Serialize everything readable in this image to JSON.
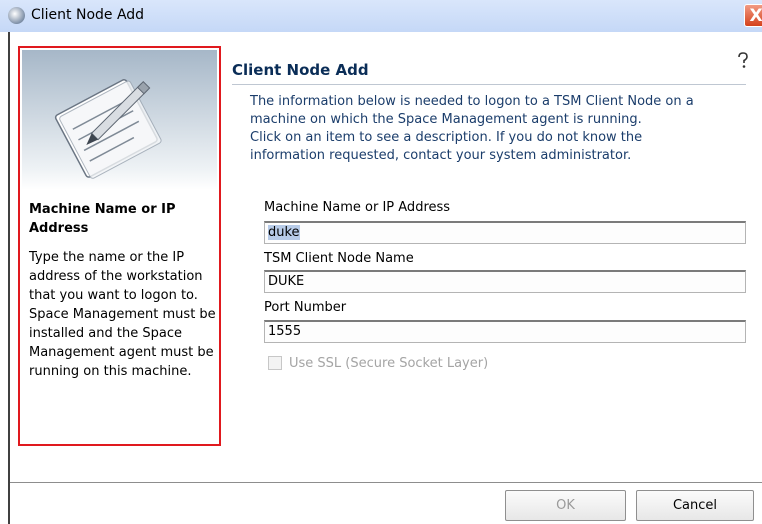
{
  "window": {
    "title": "Client Node Add",
    "close_glyph": "X",
    "icon": "globe-icon"
  },
  "sidebar": {
    "illustration": "notepad-pencil-icon",
    "help_heading": "Machine Name or IP Address",
    "help_text": "Type the name or the IP address of the workstation that you want to logon to. Space Management must be installed and the Space Management agent must be running on this machine."
  },
  "main": {
    "title": "Client Node Add",
    "help_icon": "question-icon",
    "intro_lines": [
      "The information below is needed to logon to a TSM Client Node on a",
      "machine on which the Space Management agent is running.",
      "Click on an item to see a description. If you do not know the",
      "information requested, contact your system administrator."
    ]
  },
  "form": {
    "machine_label": "Machine Name or IP Address",
    "machine_value": "duke",
    "node_label": "TSM Client Node Name",
    "node_value": "DUKE",
    "port_label": "Port Number",
    "port_value": "1555",
    "ssl_label": "Use SSL (Secure Socket Layer)",
    "ssl_checked": false,
    "ssl_enabled": false
  },
  "buttons": {
    "ok": "OK",
    "cancel": "Cancel"
  },
  "colors": {
    "sidebar_border": "#e0191e",
    "title_text": "#0a2d57",
    "selection": "#b7cbe8"
  }
}
